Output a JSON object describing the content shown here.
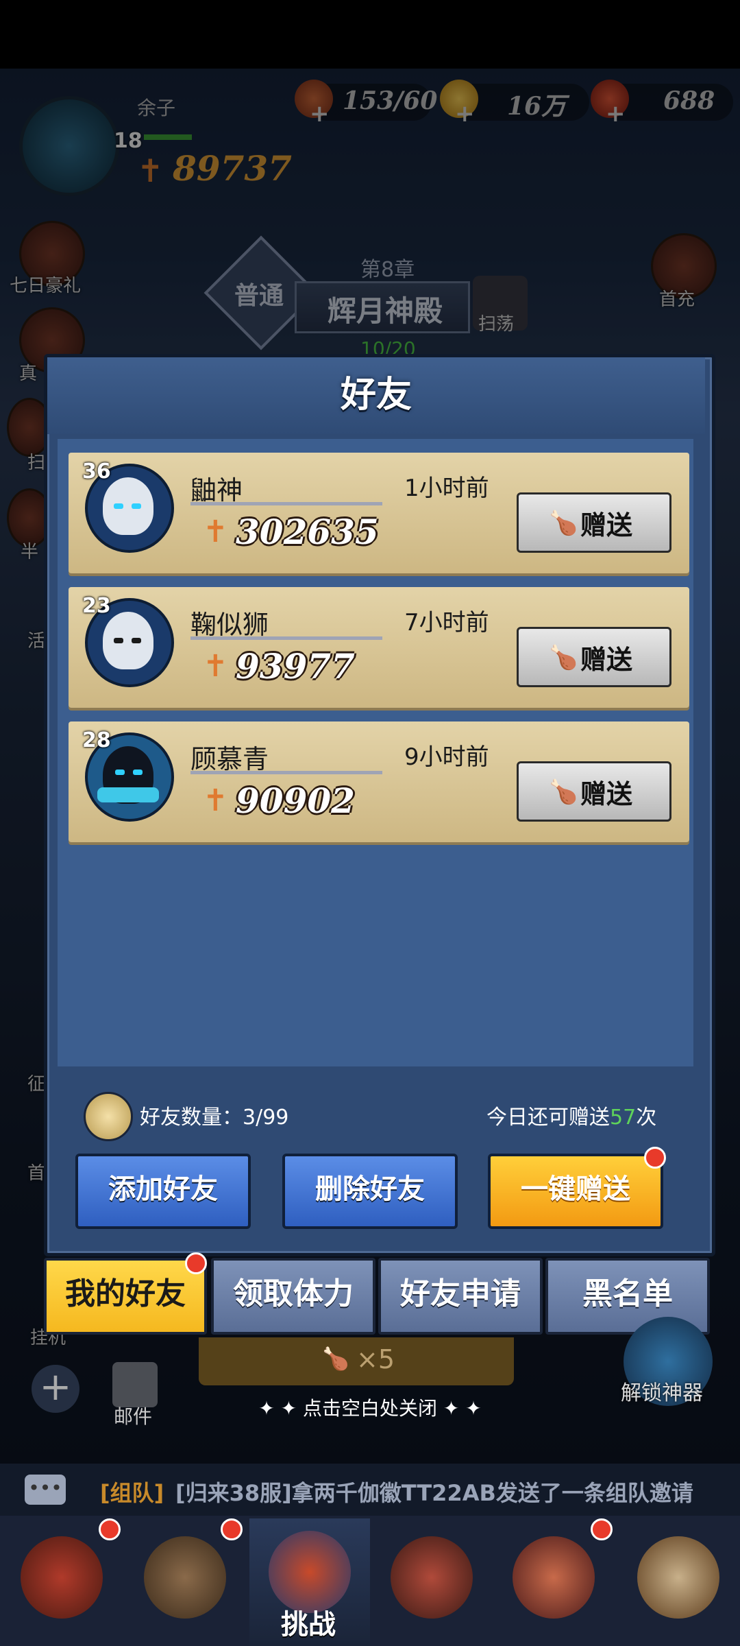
{
  "player": {
    "name": "余子",
    "level": "18",
    "power": "89737"
  },
  "resources": [
    {
      "icon": "meat-icon",
      "value": "153/60"
    },
    {
      "icon": "gold-coin-icon",
      "value": "16万"
    },
    {
      "icon": "gem-cluster-icon",
      "value": "688"
    }
  ],
  "left_side": [
    "七日豪礼",
    "真",
    "扫",
    "半",
    "活",
    "征",
    "首",
    "挂机"
  ],
  "right_side": [
    "首充"
  ],
  "chapter": {
    "label": "第8章",
    "name": "辉月神殿",
    "mode": "普通",
    "sweep": "扫荡",
    "progress": "10/20"
  },
  "dialog": {
    "title": "好友",
    "friends": [
      {
        "level": "36",
        "name": "鼬神",
        "time": "1小时前",
        "power": "302635",
        "gift_label": "赠送"
      },
      {
        "level": "23",
        "name": "鞠似狮",
        "time": "7小时前",
        "power": "93977",
        "gift_label": "赠送"
      },
      {
        "level": "28",
        "name": "顾慕青",
        "time": "9小时前",
        "power": "90902",
        "gift_label": "赠送"
      }
    ],
    "friend_count_label": "好友数量：3/99",
    "gift_remaining_prefix": "今日还可赠送",
    "gift_remaining_count": "57",
    "gift_remaining_suffix": "次",
    "buttons": {
      "add": "添加好友",
      "delete": "删除好友",
      "gift_all": "一键赠送"
    }
  },
  "tabs": [
    {
      "label": "我的好友",
      "active": true
    },
    {
      "label": "领取体力",
      "active": false
    },
    {
      "label": "好友申请",
      "active": false
    },
    {
      "label": "黑名单",
      "active": false
    }
  ],
  "challenge_cost": "×5",
  "mail_label": "邮件",
  "unlock_label": "解锁神器",
  "close_hint": "点击空白处关闭",
  "chat": {
    "channel": "[组队]",
    "message": "[归来38服]拿两千伽徽TT22AB发送了一条组队邀请"
  },
  "nav_active_label": "挑战",
  "colors": {
    "accent_gold": "#f5b81f",
    "button_blue": "#3f6fd0",
    "count_green": "#5fd35a",
    "red_dot": "#e83a2a"
  }
}
